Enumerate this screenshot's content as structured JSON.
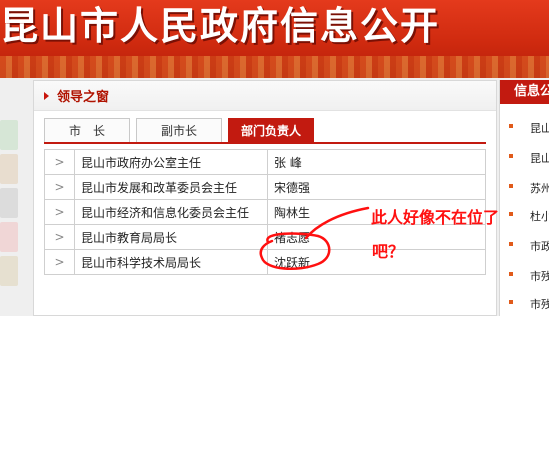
{
  "banner": {
    "title": "昆山市人民政府信息公开"
  },
  "panel": {
    "title": "领导之窗",
    "tabs": [
      {
        "label": "市　长"
      },
      {
        "label": "副市长"
      },
      {
        "label": "部门负责人",
        "active": true
      }
    ],
    "rows": [
      {
        "dept": "昆山市政府办公室主任",
        "person": "张 峰"
      },
      {
        "dept": "昆山市发展和改革委员会主任",
        "person": "宋德强"
      },
      {
        "dept": "昆山市经济和信息化委员会主任",
        "person": "陶林生"
      },
      {
        "dept": "昆山市教育局局长",
        "person": "褚志愿"
      },
      {
        "dept": "昆山市科学技术局局长",
        "person": "沈跃新"
      }
    ],
    "chevron": ">"
  },
  "right_panel": {
    "title": "信息公",
    "items": [
      "昆山",
      "昆山",
      "苏州",
      "杜小",
      "市政",
      "市残",
      "市残"
    ]
  },
  "annotation": {
    "line1": "此人好像不在位了",
    "line2": "吧？",
    "color": "#ff1010"
  },
  "colors": {
    "accent": "#c21a10",
    "banner": "#cf2a0f"
  }
}
